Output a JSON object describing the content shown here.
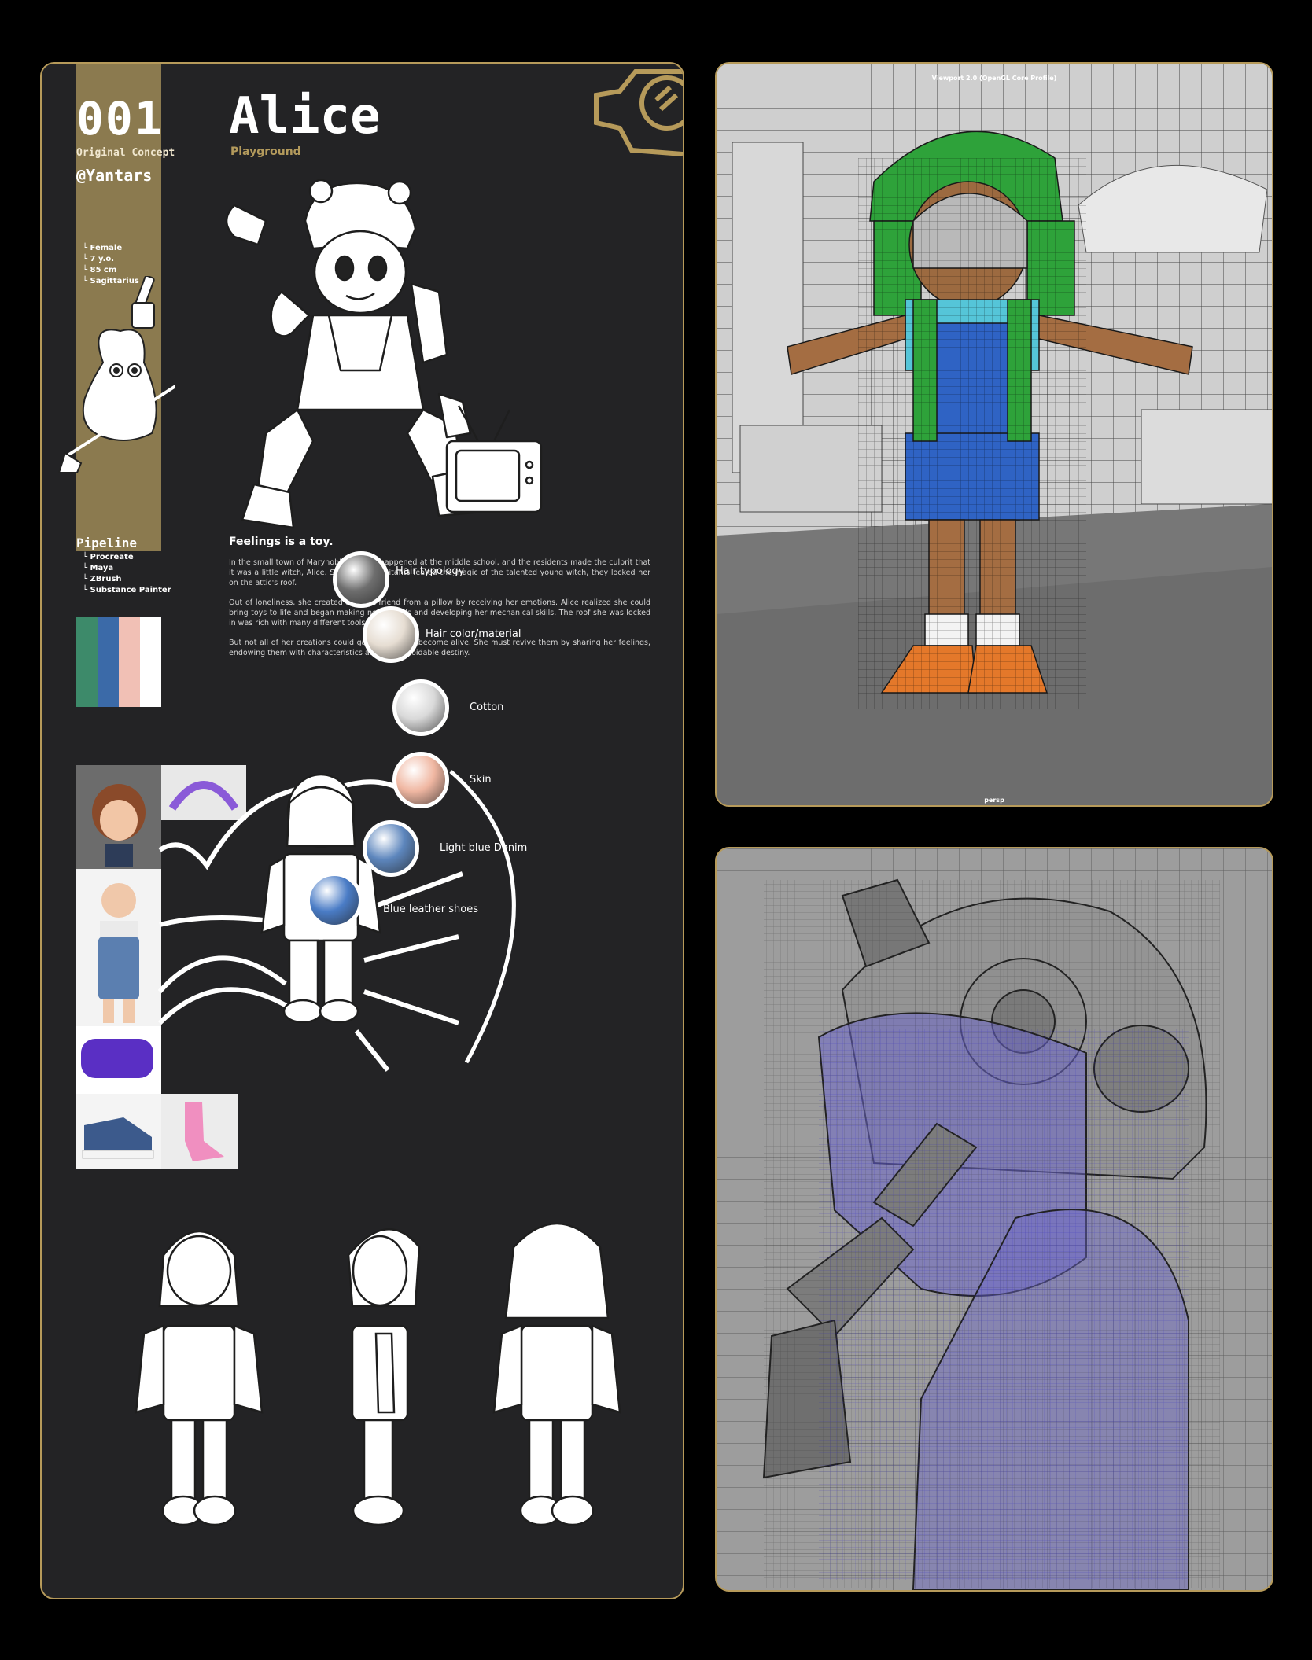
{
  "sheet": {
    "number": "001",
    "concept_label": "Original Concept",
    "handle": "@Yantars",
    "title": "Alice",
    "subtitle": "Playground",
    "facts": [
      "Female",
      "7 y.o.",
      "85 cm",
      "Sagittarius"
    ],
    "pipeline": {
      "heading": "Pipeline",
      "tools": [
        "Procreate",
        "Maya",
        "ZBrush",
        "Substance Painter"
      ]
    },
    "palette": [
      "#3d8a6a",
      "#3b6aa8",
      "#f1c0b5",
      "#ffffff"
    ],
    "story": {
      "heading": "Feelings is a toy.",
      "paragraphs": [
        "In the small town of Maryhobbits, a fire happened at the middle school, and the residents made the culprit that it was a little witch, Alice. Since the inhabitants feared the magic of the talented young witch, they locked her on the attic's roof.",
        "Out of loneliness, she created her first friend from a pillow by receiving her emotions. Alice realized she could bring toys to life and began making new friends and developing her mechanical skills. The roof she was locked in was rich with many different tools and parts.",
        "But not all of her creations could gain a soul and become alive. She must revive them by sharing her feelings, endowing them with characteristics and an unavoidable destiny."
      ]
    },
    "materials": [
      {
        "label": "Hair typology",
        "color": "#6e6e6e"
      },
      {
        "label": "Hair color/material",
        "color": "#e6ddd2"
      },
      {
        "label": "Cotton",
        "color": "#d9d9d9"
      },
      {
        "label": "Skin",
        "color": "#f0b7a2"
      },
      {
        "label": "Light blue Denim",
        "color": "#5d86bd"
      },
      {
        "label": "Blue leather shoes",
        "color": "#4a7cc6"
      }
    ],
    "accent_color": "#b69a5a"
  },
  "viewport_top": {
    "title": "Viewport 2.0 (OpenGL Core Profile)",
    "camera": "persp"
  }
}
